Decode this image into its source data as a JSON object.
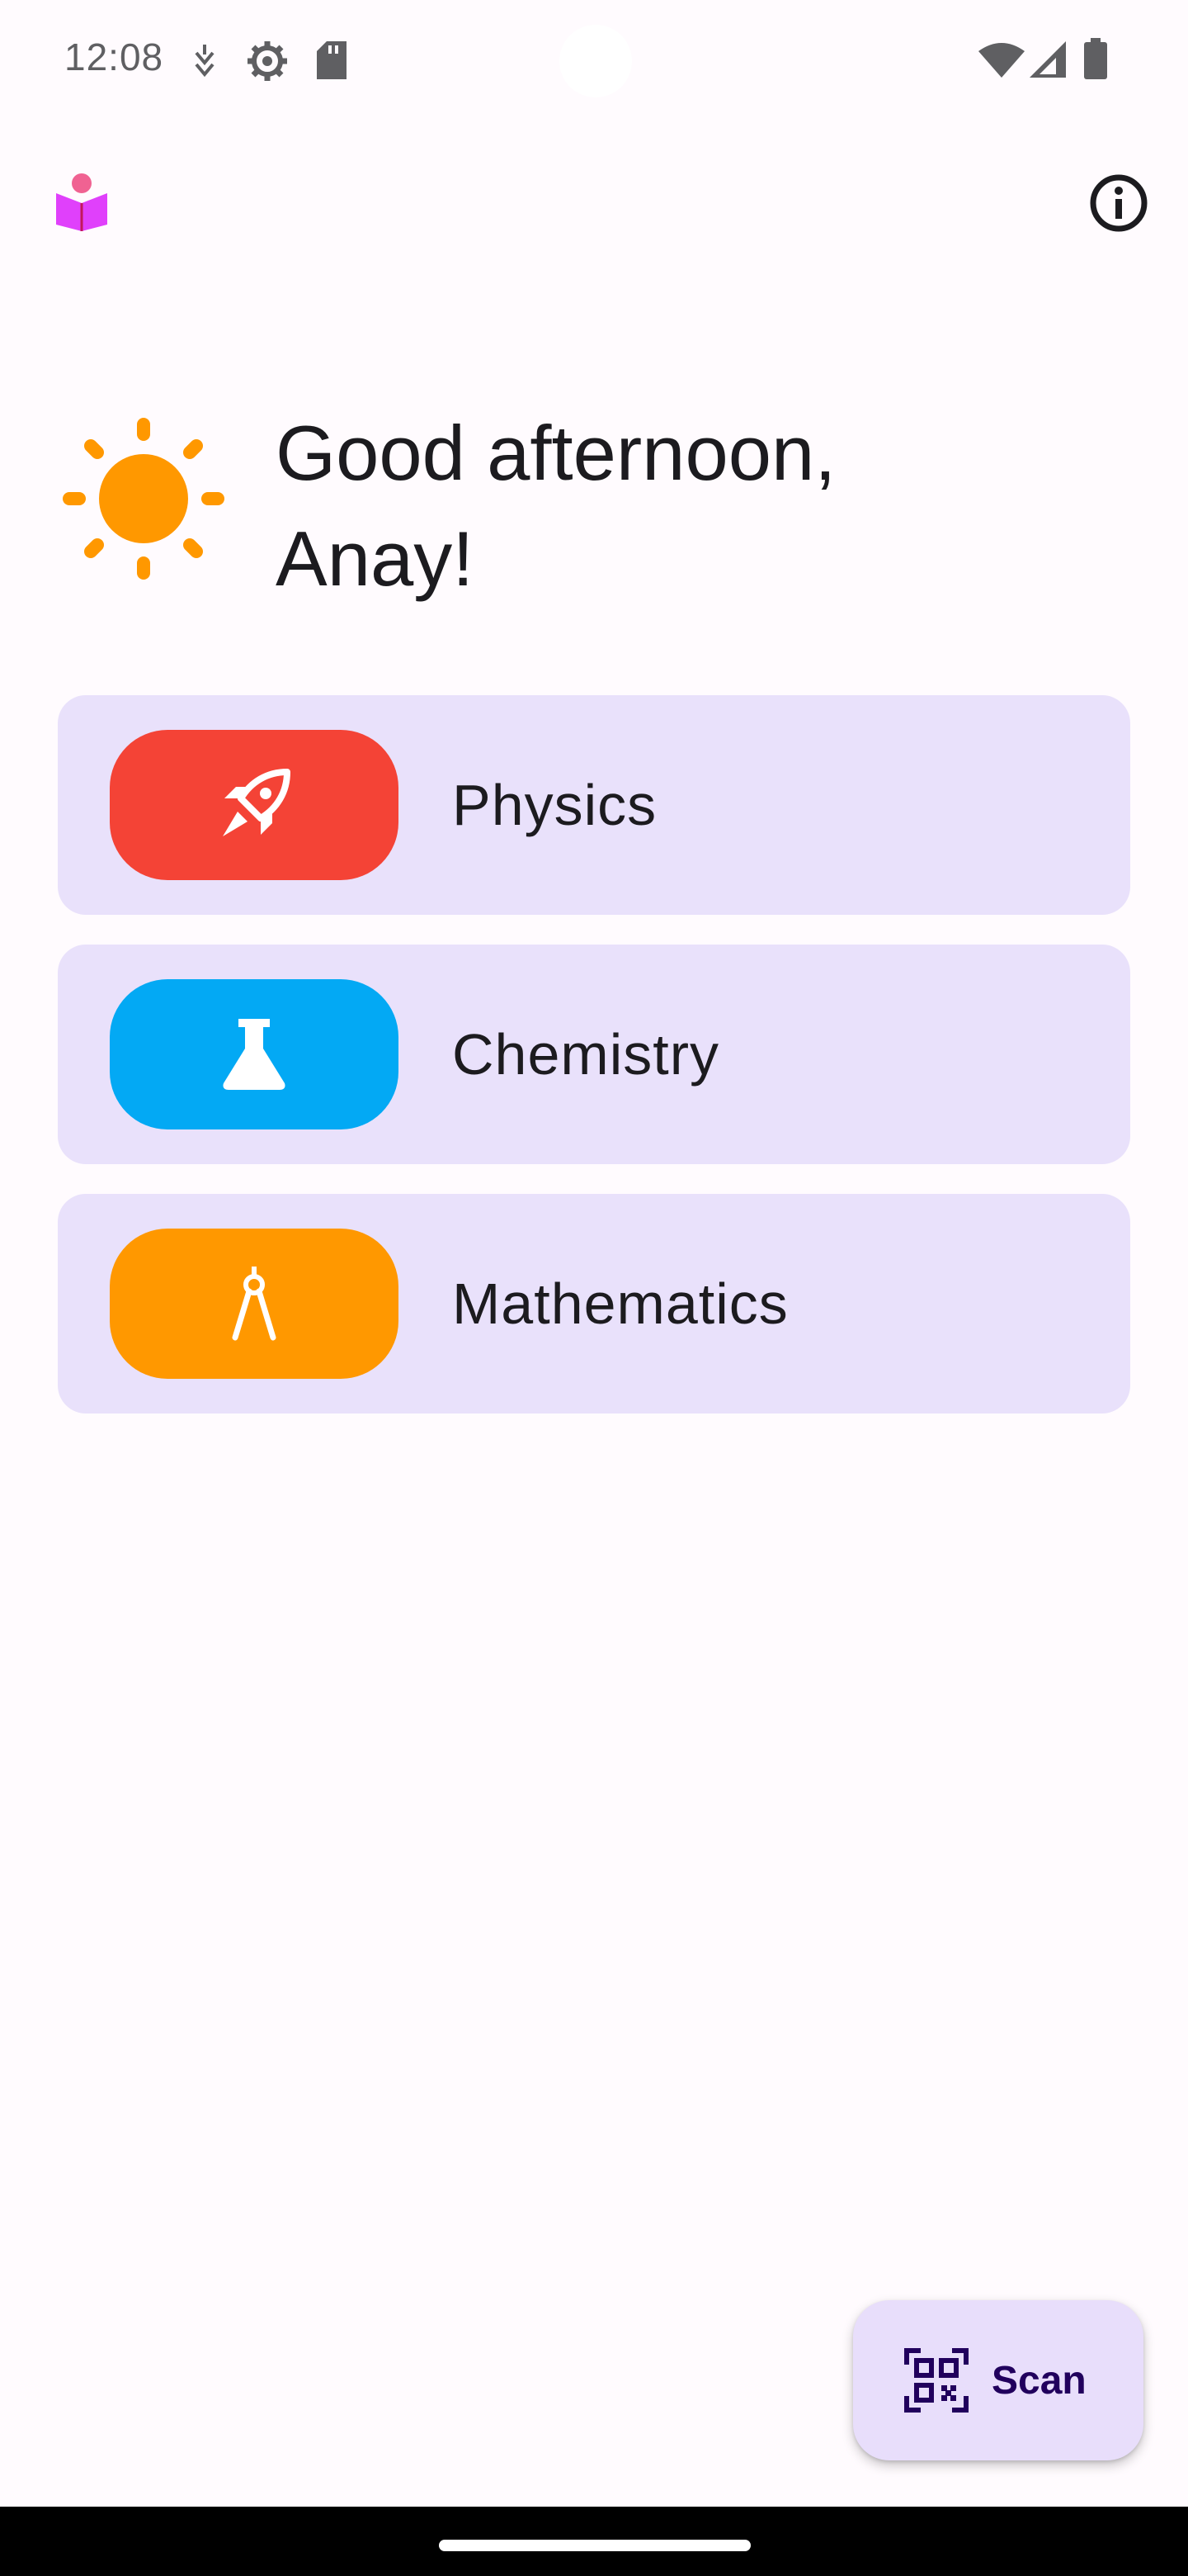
{
  "status_bar": {
    "time": "12:08",
    "icons": [
      "usb-debug-icon",
      "settings-gear-icon",
      "sd-card-icon",
      "wifi-icon",
      "cell-signal-icon",
      "battery-icon"
    ]
  },
  "app_bar": {
    "logo_icon": "reading-person-logo-icon",
    "info_icon": "info-icon"
  },
  "greeting": {
    "icon": "sun-icon",
    "text": "Good afternoon, Anay!"
  },
  "subjects": [
    {
      "label": "Physics",
      "icon": "rocket-icon",
      "color": "#f44336"
    },
    {
      "label": "Chemistry",
      "icon": "flask-icon",
      "color": "#03a9f4"
    },
    {
      "label": "Mathematics",
      "icon": "compass-icon",
      "color": "#ff9800"
    }
  ],
  "scan_fab": {
    "label": "Scan",
    "icon": "qr-scanner-icon"
  },
  "colors": {
    "background": "#fffbfe",
    "card": "#e9e1fb",
    "fab": "#e8defb",
    "sun": "#ff9800"
  }
}
